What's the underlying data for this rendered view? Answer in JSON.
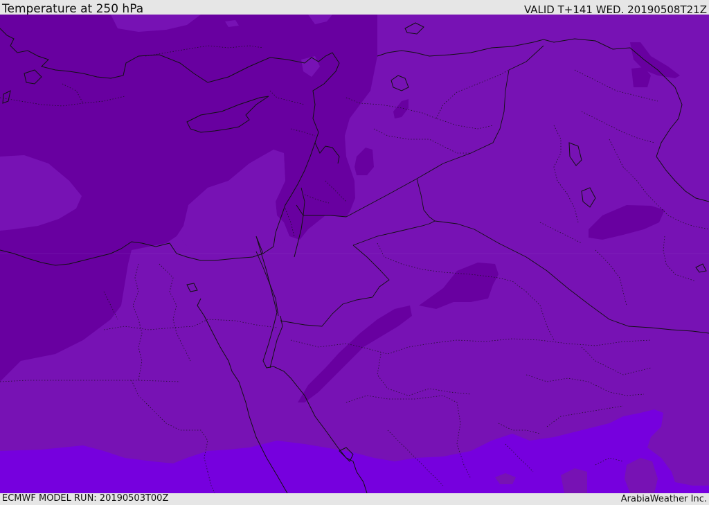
{
  "header": {
    "title": "Temperature at 250 hPa",
    "valid_label": "VALID T+141 WED. 20190508T21Z"
  },
  "footer": {
    "model_run": "ECMWF MODEL RUN: 20190503T00Z",
    "credit": "ArabiaWeather Inc."
  },
  "map": {
    "variable": "temperature",
    "pressure_level": "250 hPa",
    "colors": {
      "coldest_band": "#6800a0",
      "main_band": "#7712b4",
      "warm_band": "#7600de",
      "background": "#e6e6e6",
      "borders": "#111111"
    }
  }
}
